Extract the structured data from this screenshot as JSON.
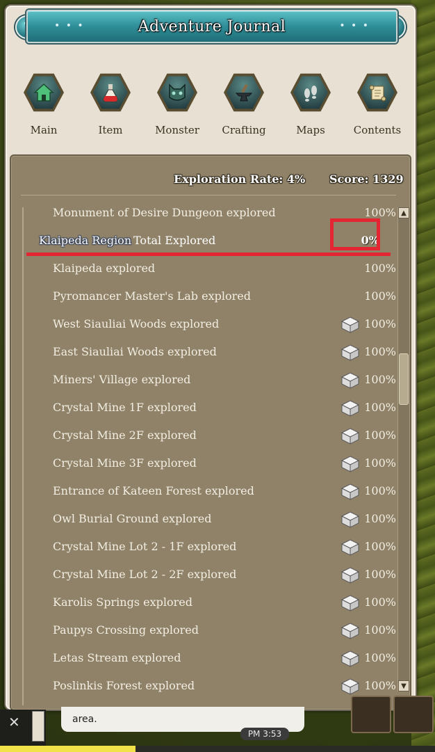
{
  "window": {
    "title": "Adventure Journal",
    "help_symbol": "?",
    "close_symbol": "✕",
    "title_dots": "• • •"
  },
  "tabs": [
    {
      "label": "Main",
      "icon": "home-icon"
    },
    {
      "label": "Item",
      "icon": "potion-icon"
    },
    {
      "label": "Monster",
      "icon": "monster-icon"
    },
    {
      "label": "Crafting",
      "icon": "anvil-icon"
    },
    {
      "label": "Maps",
      "icon": "footprints-icon"
    },
    {
      "label": "Contents",
      "icon": "scroll-icon"
    }
  ],
  "stats": {
    "exploration_rate": "Exploration Rate: 4%",
    "score": "Score: 1329"
  },
  "list": {
    "partial_top": {
      "label": "Monument of Desire Dungeon explored",
      "value": "100%"
    },
    "region": {
      "name": "Klaipeda Region",
      "total_label": "Total Explored",
      "value": "0%"
    },
    "rows": [
      {
        "label": "Klaipeda explored",
        "value": "100%",
        "has_reward": false
      },
      {
        "label": "Pyromancer Master's Lab explored",
        "value": "100%",
        "has_reward": false
      },
      {
        "label": "West Siauliai Woods explored",
        "value": "100%",
        "has_reward": true
      },
      {
        "label": "East Siauliai Woods explored",
        "value": "100%",
        "has_reward": true
      },
      {
        "label": "Miners' Village explored",
        "value": "100%",
        "has_reward": true
      },
      {
        "label": "Crystal Mine 1F explored",
        "value": "100%",
        "has_reward": true
      },
      {
        "label": "Crystal Mine 2F explored",
        "value": "100%",
        "has_reward": true
      },
      {
        "label": "Crystal Mine 3F explored",
        "value": "100%",
        "has_reward": true
      },
      {
        "label": "Entrance of Kateen Forest explored",
        "value": "100%",
        "has_reward": true
      },
      {
        "label": "Owl Burial Ground explored",
        "value": "100%",
        "has_reward": true
      },
      {
        "label": "Crystal Mine Lot 2 - 1F explored",
        "value": "100%",
        "has_reward": true
      },
      {
        "label": "Crystal Mine Lot 2 - 2F explored",
        "value": "100%",
        "has_reward": true
      },
      {
        "label": "Karolis Springs explored",
        "value": "100%",
        "has_reward": true
      },
      {
        "label": "Paupys Crossing explored",
        "value": "100%",
        "has_reward": true
      },
      {
        "label": "Letas Stream explored",
        "value": "100%",
        "has_reward": true
      },
      {
        "label": "Poslinkis Forest explored",
        "value": "100%",
        "has_reward": true
      }
    ],
    "scroll_up": "▲",
    "scroll_down": "▼"
  },
  "chat": {
    "text": "area.",
    "clock": "PM 3:53"
  },
  "colors": {
    "highlight": "#e32631",
    "panel": "#8f8268",
    "title_bar": "#2f8e98"
  }
}
